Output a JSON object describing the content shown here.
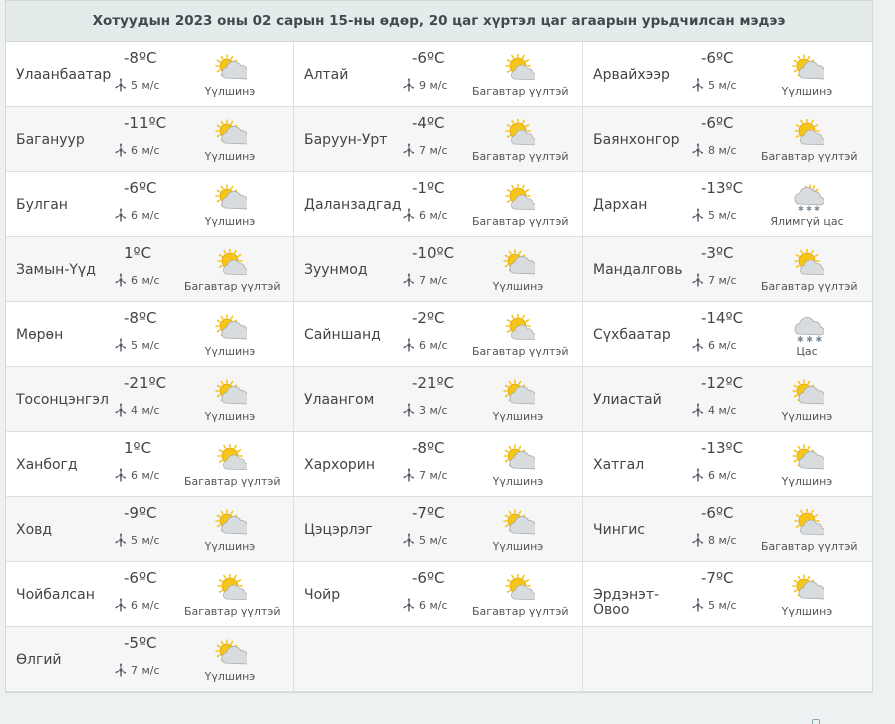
{
  "header": {
    "title": "Хотуудын 2023 оны 02 сарын 15-ны өдөр, 20 цаг хүртэл цаг агаарын урьдчилсан мэдээ"
  },
  "colors": {
    "sun": "#f5c518",
    "sun_edge": "#e2a10c",
    "cloud": "#d9dcde",
    "cloud_edge": "#a9aeb2"
  },
  "cities": [
    {
      "name": "Улаанбаатар",
      "temp": "-8ºC",
      "wind": "5 м/с",
      "condition": "Үүлшинэ",
      "icon": "partly-cloudy-icon"
    },
    {
      "name": "Алтай",
      "temp": "-6ºC",
      "wind": "9 м/с",
      "condition": "Багавтар үүлтэй",
      "icon": "mostly-sunny-icon"
    },
    {
      "name": "Арвайхээр",
      "temp": "-6ºC",
      "wind": "5 м/с",
      "condition": "Үүлшинэ",
      "icon": "partly-cloudy-icon"
    },
    {
      "name": "Багануур",
      "temp": "-11ºC",
      "wind": "6 м/с",
      "condition": "Үүлшинэ",
      "icon": "partly-cloudy-icon"
    },
    {
      "name": "Баруун-Урт",
      "temp": "-4ºC",
      "wind": "7 м/с",
      "condition": "Багавтар үүлтэй",
      "icon": "mostly-sunny-icon"
    },
    {
      "name": "Баянхонгор",
      "temp": "-6ºC",
      "wind": "8 м/с",
      "condition": "Багавтар үүлтэй",
      "icon": "mostly-sunny-icon"
    },
    {
      "name": "Булган",
      "temp": "-6ºC",
      "wind": "6 м/с",
      "condition": "Үүлшинэ",
      "icon": "partly-cloudy-icon"
    },
    {
      "name": "Даланзадгад",
      "temp": "-1ºC",
      "wind": "6 м/с",
      "condition": "Багавтар үүлтэй",
      "icon": "mostly-sunny-icon"
    },
    {
      "name": "Дархан",
      "temp": "-13ºC",
      "wind": "5 м/с",
      "condition": "Ялимгүй цас",
      "icon": "light-snow-icon"
    },
    {
      "name": "Замын-Үүд",
      "temp": "1ºC",
      "wind": "6 м/с",
      "condition": "Багавтар үүлтэй",
      "icon": "mostly-sunny-icon"
    },
    {
      "name": "Зуунмод",
      "temp": "-10ºC",
      "wind": "7 м/с",
      "condition": "Үүлшинэ",
      "icon": "partly-cloudy-icon"
    },
    {
      "name": "Мандалговь",
      "temp": "-3ºC",
      "wind": "7 м/с",
      "condition": "Багавтар үүлтэй",
      "icon": "mostly-sunny-icon"
    },
    {
      "name": "Мөрөн",
      "temp": "-8ºC",
      "wind": "5 м/с",
      "condition": "Үүлшинэ",
      "icon": "partly-cloudy-icon"
    },
    {
      "name": "Сайншанд",
      "temp": "-2ºC",
      "wind": "6 м/с",
      "condition": "Багавтар үүлтэй",
      "icon": "mostly-sunny-icon"
    },
    {
      "name": "Сүхбаатар",
      "temp": "-14ºC",
      "wind": "6 м/с",
      "condition": "Цас",
      "icon": "snow-icon"
    },
    {
      "name": "Тосонцэнгэл",
      "temp": "-21ºC",
      "wind": "4 м/с",
      "condition": "Үүлшинэ",
      "icon": "partly-cloudy-icon"
    },
    {
      "name": "Улаангом",
      "temp": "-21ºC",
      "wind": "3 м/с",
      "condition": "Үүлшинэ",
      "icon": "partly-cloudy-icon"
    },
    {
      "name": "Улиастай",
      "temp": "-12ºC",
      "wind": "4 м/с",
      "condition": "Үүлшинэ",
      "icon": "partly-cloudy-icon"
    },
    {
      "name": "Ханбогд",
      "temp": "1ºC",
      "wind": "6 м/с",
      "condition": "Багавтар үүлтэй",
      "icon": "mostly-sunny-icon"
    },
    {
      "name": "Хархорин",
      "temp": "-8ºC",
      "wind": "7 м/с",
      "condition": "Үүлшинэ",
      "icon": "partly-cloudy-icon"
    },
    {
      "name": "Хатгал",
      "temp": "-13ºC",
      "wind": "6 м/с",
      "condition": "Үүлшинэ",
      "icon": "partly-cloudy-icon"
    },
    {
      "name": "Ховд",
      "temp": "-9ºC",
      "wind": "5 м/с",
      "condition": "Үүлшинэ",
      "icon": "partly-cloudy-icon"
    },
    {
      "name": "Цэцэрлэг",
      "temp": "-7ºC",
      "wind": "5 м/с",
      "condition": "Үүлшинэ",
      "icon": "partly-cloudy-icon"
    },
    {
      "name": "Чингис",
      "temp": "-6ºC",
      "wind": "8 м/с",
      "condition": "Багавтар үүлтэй",
      "icon": "mostly-sunny-icon"
    },
    {
      "name": "Чойбалсан",
      "temp": "-6ºC",
      "wind": "6 м/с",
      "condition": "Багавтар үүлтэй",
      "icon": "mostly-sunny-icon"
    },
    {
      "name": "Чойр",
      "temp": "-6ºC",
      "wind": "6 м/с",
      "condition": "Багавтар үүлтэй",
      "icon": "mostly-sunny-icon"
    },
    {
      "name": "Эрдэнэт-Овоо",
      "temp": "-7ºC",
      "wind": "5 м/с",
      "condition": "Үүлшинэ",
      "icon": "partly-cloudy-icon"
    },
    {
      "name": "Өлгий",
      "temp": "-5ºC",
      "wind": "7 м/с",
      "condition": "Үүлшинэ",
      "icon": "partly-cloudy-icon"
    }
  ]
}
